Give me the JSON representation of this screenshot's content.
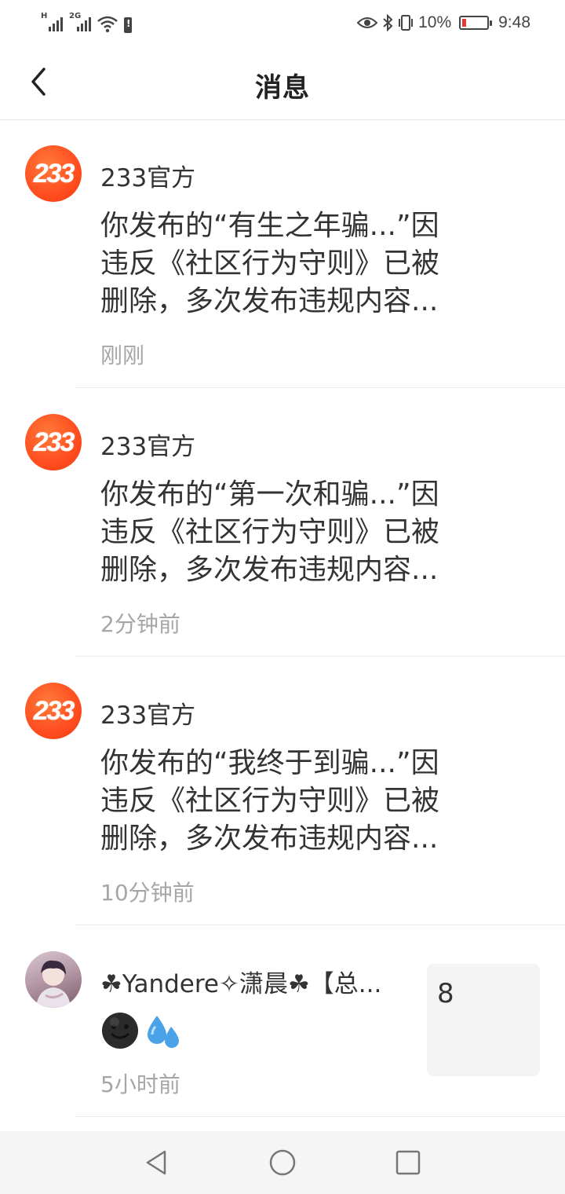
{
  "status_bar": {
    "signal1_tag": "H",
    "signal2_tag": "2G",
    "battery_percent": "10%",
    "time": "9:48"
  },
  "header": {
    "title": "消息"
  },
  "messages": [
    {
      "sender": "233官方",
      "avatar_text": "233",
      "lines": [
        "你发布的“有生之年骗...”因",
        "违反《社区行为守则》已被",
        "删除，多次发布违规内容..."
      ],
      "time": "刚刚"
    },
    {
      "sender": "233官方",
      "avatar_text": "233",
      "lines": [
        "你发布的“第一次和骗...”因",
        "违反《社区行为守则》已被",
        "删除，多次发布违规内容..."
      ],
      "time": "2分钟前"
    },
    {
      "sender": "233官方",
      "avatar_text": "233",
      "lines": [
        "你发布的“我终于到骗...”因",
        "违反《社区行为守则》已被",
        "删除，多次发布违规内容..."
      ],
      "time": "10分钟前"
    },
    {
      "sender": "☘Yandere✧潇晨☘【总...",
      "emojis": [
        "smiling-face-icon",
        "sweat-droplets-icon"
      ],
      "time": "5小时前",
      "thumb_text": "8"
    }
  ],
  "colors": {
    "brand_orange": "#ff4d1f",
    "time_gray": "#a6a6a6"
  }
}
